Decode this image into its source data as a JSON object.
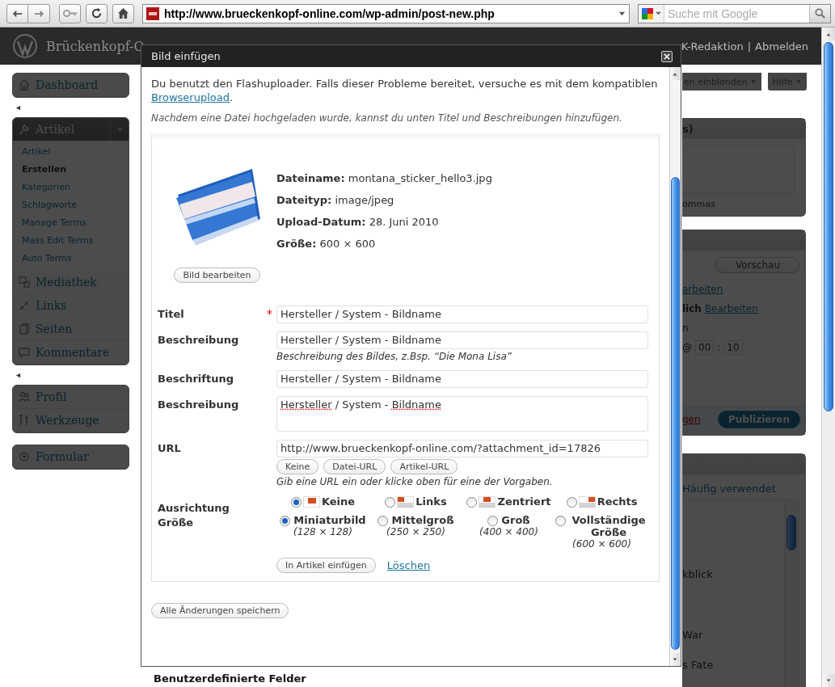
{
  "browser": {
    "url": "http://www.brueckenkopf-online.com/wp-admin/post-new.php",
    "search_placeholder": "Suche mit Google"
  },
  "admin_header": {
    "site_title": "Brückenkopf-O",
    "user": "K-Redaktion",
    "separator": "|",
    "logout": "Abmelden"
  },
  "sidebar": [
    {
      "kind": "group",
      "items": [
        {
          "label": "Dashboard",
          "expanded": false
        }
      ]
    },
    {
      "kind": "separator"
    },
    {
      "kind": "group",
      "items": [
        {
          "label": "Artikel",
          "expanded": true,
          "children": [
            {
              "label": "Artikel",
              "selected": false
            },
            {
              "label": "Erstellen",
              "selected": true
            },
            {
              "label": "Kategorien",
              "selected": false
            },
            {
              "label": "Schlagworte",
              "selected": false
            },
            {
              "label": "Manage Terms",
              "selected": false
            },
            {
              "label": "Mass Edit Terms",
              "selected": false
            },
            {
              "label": "Auto Terms",
              "selected": false
            }
          ]
        },
        {
          "label": "Mediathek",
          "expanded": false
        },
        {
          "label": "Links",
          "expanded": false
        },
        {
          "label": "Seiten",
          "expanded": false
        },
        {
          "label": "Kommentare",
          "expanded": false
        }
      ]
    },
    {
      "kind": "separator"
    },
    {
      "kind": "group",
      "items": [
        {
          "label": "Profil",
          "expanded": false
        },
        {
          "label": "Werkzeuge",
          "expanded": false
        }
      ]
    },
    {
      "kind": "gap"
    },
    {
      "kind": "group",
      "items": [
        {
          "label": "Formular",
          "expanded": false
        }
      ]
    }
  ],
  "right_panel": {
    "screen_options": "en einblenden",
    "help": "Hilfe",
    "tags_box": {
      "title": "s)",
      "hint": "ommas"
    },
    "publish_box": {
      "preview": "Vorschau",
      "edit_link": "arbeiten",
      "status_label": "lich",
      "status_link": "Bearbeiten",
      "line_fragment": "n",
      "time_at": "@",
      "hour": "00",
      "time_sep": ":",
      "minute": "10",
      "trash_link": "gen",
      "publish": "Publizieren"
    },
    "categories_box": {
      "tab": "Häufig verwendet",
      "items": [
        "kblick",
        "War",
        "s Fate"
      ]
    }
  },
  "bottom_box_title": "Benutzerdefinierte Felder",
  "dialog": {
    "title": "Bild einfügen",
    "intro": "Du benutzt den Flashuploader. Falls dieser Probleme bereitet, versuche es mit dem kompatiblen",
    "intro_link": "Browserupload",
    "intro_end": ".",
    "hint": "Nachdem eine Datei hochgeladen wurde, kannst du unten Titel und Beschreibungen hinzufügen.",
    "file_info": [
      {
        "label": "Dateiname:",
        "value": "montana_sticker_hello3.jpg"
      },
      {
        "label": "Dateityp:",
        "value": "image/jpeg"
      },
      {
        "label": "Upload-Datum:",
        "value": "28. Juni 2010"
      },
      {
        "label": "Größe:",
        "value": "600 × 600"
      }
    ],
    "edit_image": "Bild bearbeiten",
    "fields": [
      {
        "kind": "text",
        "label": "Titel",
        "required_mark": "*",
        "value": "Hersteller / System - Bildname"
      },
      {
        "kind": "text",
        "label": "Beschreibung",
        "value": "Hersteller / System - Bildname",
        "help": "Beschreibung des Bildes, z.Bsp. “Die Mona Lisa”"
      },
      {
        "kind": "text",
        "label": "Beschriftung",
        "value": "Hersteller / System - Bildname"
      },
      {
        "kind": "textarea",
        "label": "Beschreibung",
        "value_parts": [
          {
            "text": "Hersteller",
            "misspelled": true
          },
          {
            "text": " / System - ",
            "misspelled": false
          },
          {
            "text": "Bildname",
            "misspelled": true
          }
        ]
      },
      {
        "kind": "url",
        "label": "URL",
        "value": "http://www.brueckenkopf-online.com/?attachment_id=17826",
        "buttons": [
          "Keine",
          "Datei-URL",
          "Artikel-URL"
        ],
        "help": "Gib eine URL ein oder klicke oben für eine der Vorgaben."
      }
    ],
    "alignment": {
      "label": "Ausrichtung",
      "options": [
        {
          "label": "Keine",
          "selected": true
        },
        {
          "label": "Links",
          "selected": false
        },
        {
          "label": "Zentriert",
          "selected": false
        },
        {
          "label": "Rechts",
          "selected": false
        }
      ]
    },
    "size": {
      "label": "Größe",
      "options": [
        {
          "label": "Miniaturbild",
          "dims": "(128 × 128)",
          "selected": true
        },
        {
          "label": "Mittelgroß",
          "dims": "(250 × 250)",
          "selected": false
        },
        {
          "label": "Groß",
          "dims": "(400 × 400)",
          "selected": false
        },
        {
          "label": "Vollständige Größe",
          "dims": "(600 × 600)",
          "selected": false
        }
      ]
    },
    "insert_button": "In Artikel einfügen",
    "delete_link": "Löschen",
    "save_all": "Alle Änderungen speichern"
  }
}
